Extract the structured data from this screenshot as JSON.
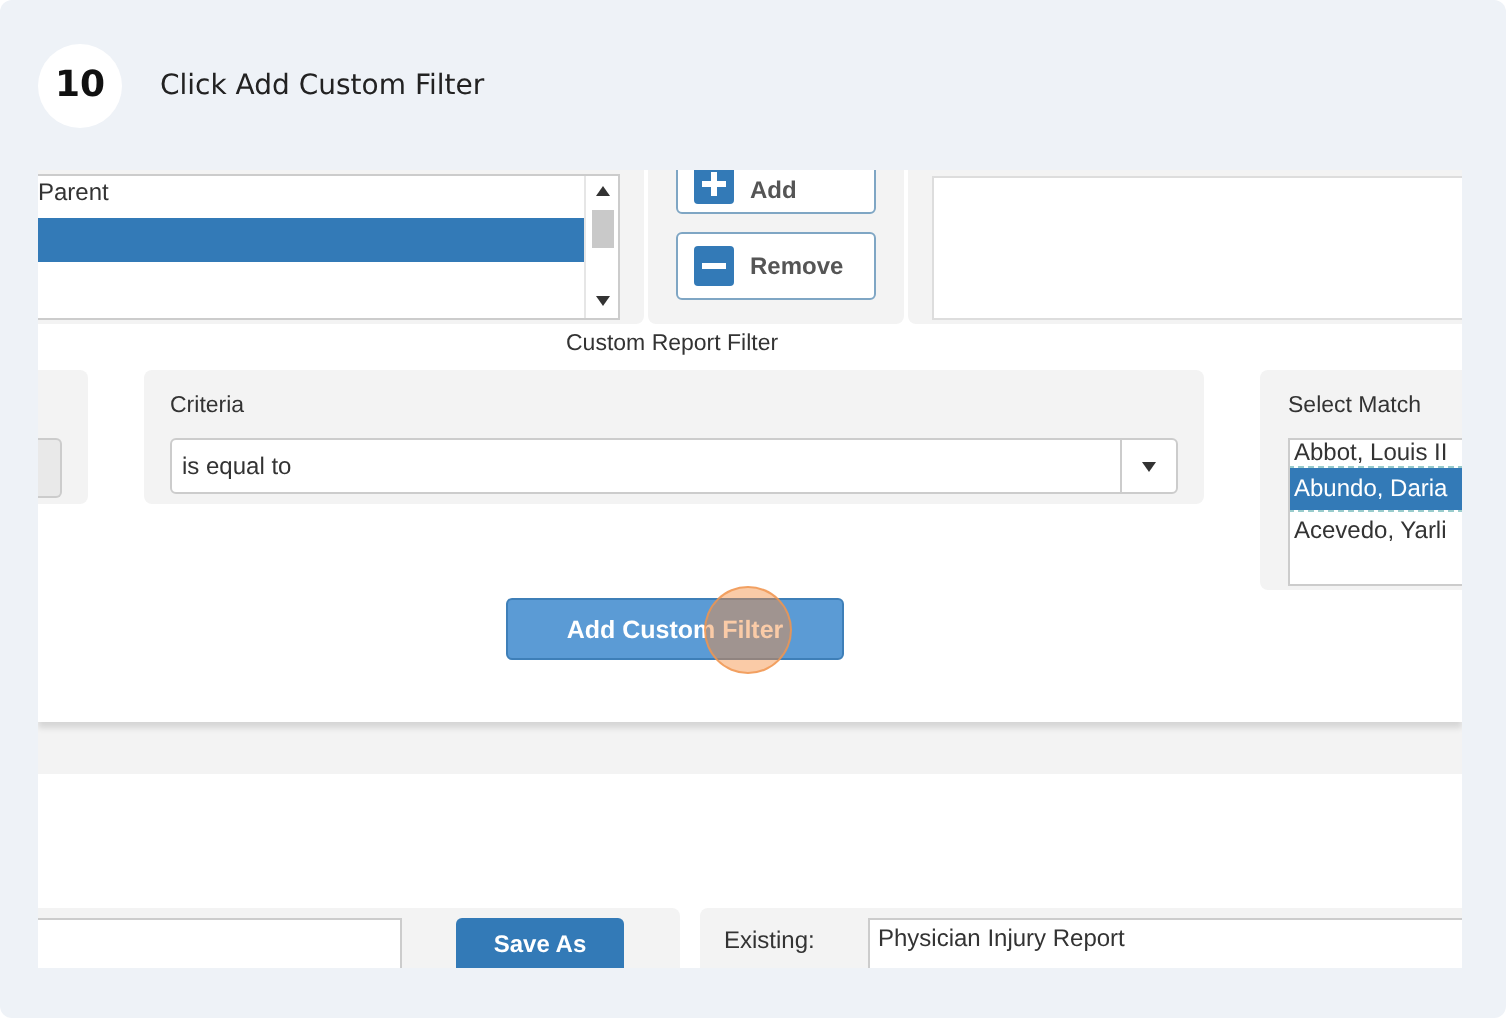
{
  "step": {
    "number": "10",
    "instruction": "Click Add Custom Filter"
  },
  "field_list": {
    "rows": [
      {
        "label": "Parent",
        "selected": false
      },
      {
        "selected": true
      }
    ]
  },
  "list_buttons": [
    {
      "label": "Add",
      "kind": "plus"
    },
    {
      "label": "Remove",
      "kind": "minus"
    }
  ],
  "caption": "Custom Report Filter",
  "criteria": {
    "label": "Criteria",
    "value": "is equal to"
  },
  "select_match": {
    "label": "Select Match",
    "items": [
      {
        "label": "Abbot, Louis II",
        "selected": false
      },
      {
        "label": "Abundo, Daria",
        "selected": true
      },
      {
        "label": "Acevedo, Yarli",
        "selected": false
      }
    ]
  },
  "add_filter_button": {
    "label": "Add Custom Filter",
    "highlighted": true
  },
  "save_as_button": {
    "label": "Save As"
  },
  "existing": {
    "label": "Existing:",
    "value": "Physician Injury Report"
  }
}
